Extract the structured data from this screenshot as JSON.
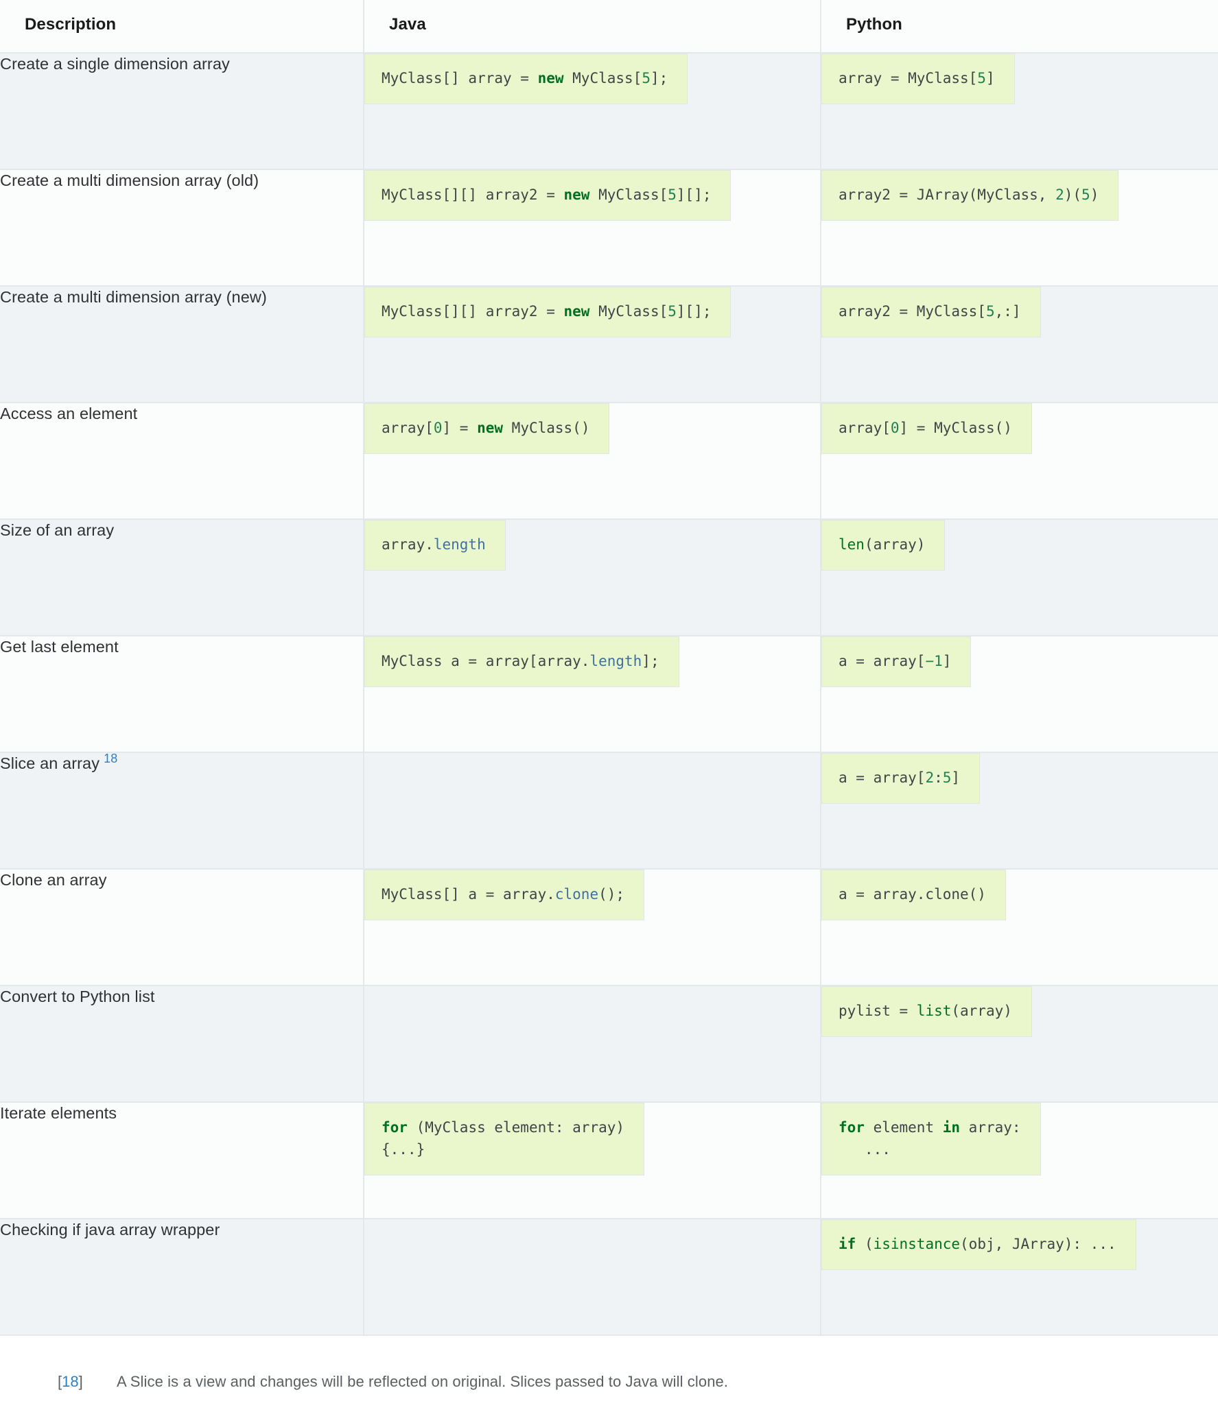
{
  "table": {
    "headers": [
      "Description",
      "Java",
      "Python"
    ],
    "rows": [
      {
        "description": "Create a single dimension array",
        "footnote_ref": null,
        "java": [
          [
            {
              "t": "MyClass[] array = ",
              "c": "p"
            },
            {
              "t": "new",
              "c": "k"
            },
            {
              "t": " MyClass[",
              "c": "p"
            },
            {
              "t": "5",
              "c": "mi"
            },
            {
              "t": "];",
              "c": "p"
            }
          ]
        ],
        "python": [
          [
            {
              "t": "array = MyClass[",
              "c": "p"
            },
            {
              "t": "5",
              "c": "mi"
            },
            {
              "t": "]",
              "c": "p"
            }
          ]
        ]
      },
      {
        "description": "Create a multi dimension array (old)",
        "footnote_ref": null,
        "java": [
          [
            {
              "t": "MyClass[][] array2 = ",
              "c": "p"
            },
            {
              "t": "new",
              "c": "k"
            },
            {
              "t": " MyClass[",
              "c": "p"
            },
            {
              "t": "5",
              "c": "mi"
            },
            {
              "t": "][];",
              "c": "p"
            }
          ]
        ],
        "python": [
          [
            {
              "t": "array2 = JArray(MyClass, ",
              "c": "p"
            },
            {
              "t": "2",
              "c": "mi"
            },
            {
              "t": ")(",
              "c": "p"
            },
            {
              "t": "5",
              "c": "mi"
            },
            {
              "t": ")",
              "c": "p"
            }
          ]
        ]
      },
      {
        "description": "Create a multi dimension array (new)",
        "footnote_ref": null,
        "java": [
          [
            {
              "t": "MyClass[][] array2 = ",
              "c": "p"
            },
            {
              "t": "new",
              "c": "k"
            },
            {
              "t": " MyClass[",
              "c": "p"
            },
            {
              "t": "5",
              "c": "mi"
            },
            {
              "t": "][];",
              "c": "p"
            }
          ]
        ],
        "python": [
          [
            {
              "t": "array2 = MyClass[",
              "c": "p"
            },
            {
              "t": "5",
              "c": "mi"
            },
            {
              "t": ",:]",
              "c": "p"
            }
          ]
        ]
      },
      {
        "description": "Access an element",
        "footnote_ref": null,
        "java": [
          [
            {
              "t": "array[",
              "c": "p"
            },
            {
              "t": "0",
              "c": "mi"
            },
            {
              "t": "] = ",
              "c": "p"
            },
            {
              "t": "new",
              "c": "k"
            },
            {
              "t": " MyClass()",
              "c": "p"
            }
          ]
        ],
        "python": [
          [
            {
              "t": "array[",
              "c": "p"
            },
            {
              "t": "0",
              "c": "mi"
            },
            {
              "t": "] = MyClass()",
              "c": "p"
            }
          ]
        ]
      },
      {
        "description": "Size of an array",
        "footnote_ref": null,
        "java": [
          [
            {
              "t": "array.",
              "c": "p"
            },
            {
              "t": "length",
              "c": "na"
            }
          ]
        ],
        "python": [
          [
            {
              "t": "len",
              "c": "nb"
            },
            {
              "t": "(array)",
              "c": "p"
            }
          ]
        ]
      },
      {
        "description": "Get last element",
        "footnote_ref": null,
        "java": [
          [
            {
              "t": "MyClass a = array[array.",
              "c": "p"
            },
            {
              "t": "length",
              "c": "na"
            },
            {
              "t": "];",
              "c": "p"
            }
          ]
        ],
        "python": [
          [
            {
              "t": "a = array[",
              "c": "p"
            },
            {
              "t": "−1",
              "c": "mi"
            },
            {
              "t": "]",
              "c": "p"
            }
          ]
        ]
      },
      {
        "description": "Slice an array",
        "footnote_ref": "18",
        "java": [],
        "python": [
          [
            {
              "t": "a = array[",
              "c": "p"
            },
            {
              "t": "2",
              "c": "mi"
            },
            {
              "t": ":",
              "c": "p"
            },
            {
              "t": "5",
              "c": "mi"
            },
            {
              "t": "]",
              "c": "p"
            }
          ]
        ]
      },
      {
        "description": "Clone an array",
        "footnote_ref": null,
        "java": [
          [
            {
              "t": "MyClass[] a = array.",
              "c": "p"
            },
            {
              "t": "clone",
              "c": "na"
            },
            {
              "t": "();",
              "c": "p"
            }
          ]
        ],
        "python": [
          [
            {
              "t": "a = array.clone()",
              "c": "p"
            }
          ]
        ]
      },
      {
        "description": "Convert to Python list",
        "footnote_ref": null,
        "java": [],
        "python": [
          [
            {
              "t": "pylist = ",
              "c": "p"
            },
            {
              "t": "list",
              "c": "nb"
            },
            {
              "t": "(array)",
              "c": "p"
            }
          ]
        ]
      },
      {
        "description": "Iterate elements",
        "footnote_ref": null,
        "java": [
          [
            {
              "t": "for",
              "c": "k"
            },
            {
              "t": " (MyClass element: array)",
              "c": "p"
            }
          ],
          [
            {
              "t": "{...}",
              "c": "p"
            }
          ]
        ],
        "python": [
          [
            {
              "t": "for",
              "c": "k"
            },
            {
              "t": " element ",
              "c": "p"
            },
            {
              "t": "in",
              "c": "k"
            },
            {
              "t": " array:",
              "c": "p"
            }
          ],
          [
            {
              "t": "   ...",
              "c": "p"
            }
          ]
        ]
      },
      {
        "description": "Checking if java array wrapper",
        "footnote_ref": null,
        "java": [],
        "python": [
          [
            {
              "t": "if",
              "c": "k"
            },
            {
              "t": " (",
              "c": "p"
            },
            {
              "t": "isinstance",
              "c": "nb"
            },
            {
              "t": "(obj, JArray): ...",
              "c": "p"
            }
          ]
        ]
      }
    ]
  },
  "footnotes": [
    {
      "label_open": "[",
      "number": "18",
      "label_close": "]",
      "text": "A Slice is a view and changes will be reflected on original. Slices passed to Java will clone."
    }
  ],
  "colors": {
    "keyword": "#007020",
    "builtin": "#007020",
    "number": "#208050",
    "attribute": "#4070a0",
    "code_background": "#eaf7cd",
    "row_odd": "#eff3f5",
    "row_even": "#fbfcfc",
    "border": "#e3e8ea",
    "link": "#2e7fc1"
  }
}
